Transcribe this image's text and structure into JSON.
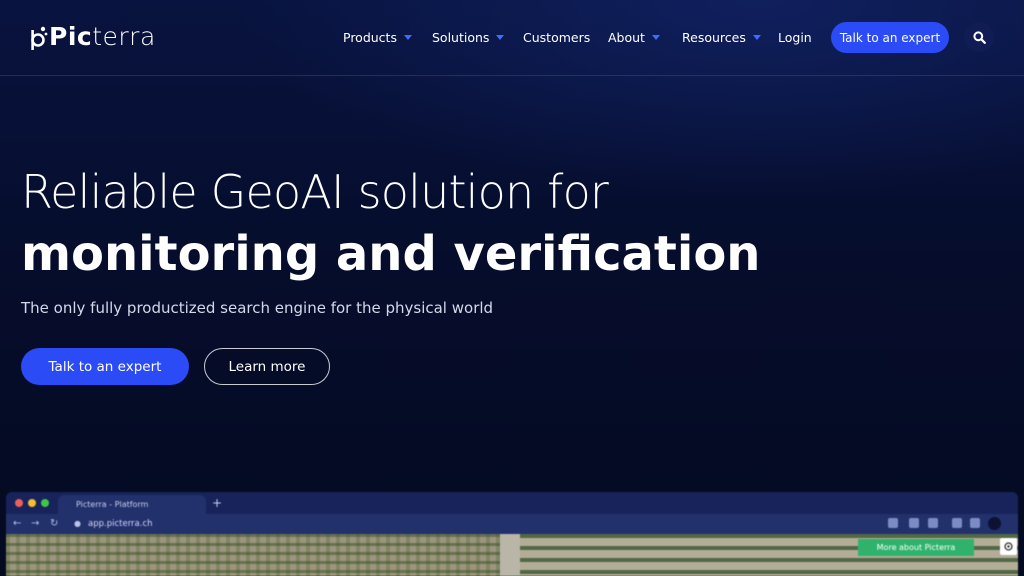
{
  "brand": {
    "logo_text_bold": "Pic",
    "logo_text_light": "terra"
  },
  "nav": {
    "items": [
      {
        "label": "Products",
        "has_dropdown": true
      },
      {
        "label": "Solutions",
        "has_dropdown": true
      },
      {
        "label": "Customers",
        "has_dropdown": false
      },
      {
        "label": "About",
        "has_dropdown": true
      },
      {
        "label": "Resources",
        "has_dropdown": true
      },
      {
        "label": "Login",
        "has_dropdown": false
      }
    ],
    "cta_label": "Talk to an expert",
    "search_icon": "search-icon"
  },
  "hero": {
    "title_line1": "Reliable GeoAI solution for",
    "title_line2": "monitoring and verification",
    "subtitle": "The only fully productized search engine for the physical world",
    "primary_cta": "Talk to an expert",
    "secondary_cta": "Learn more"
  },
  "preview": {
    "tab_title": "Picterra - Platform",
    "url": "app.picterra.ch",
    "more_button": "More about Picterra"
  },
  "colors": {
    "accent": "#2a4bf5",
    "background": "#060d2c",
    "more_button": "#2fb36c"
  }
}
